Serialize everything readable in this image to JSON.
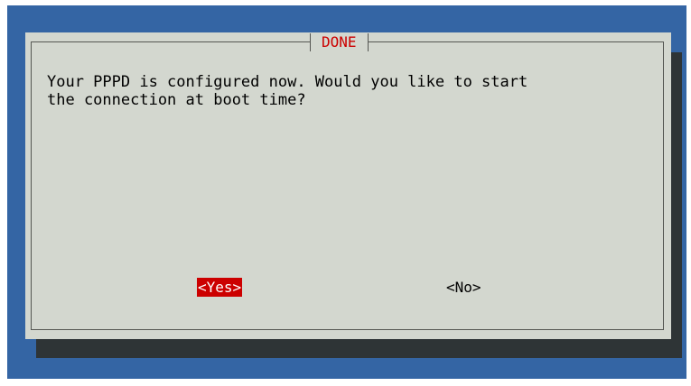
{
  "dialog": {
    "title": "DONE",
    "message": "Your PPPD is configured now. Would you like to start\nthe connection at boot time?",
    "buttons": {
      "yes_label": "<Yes>",
      "no_label": "<No>"
    }
  },
  "colors": {
    "screen_background": "#3465a4",
    "dialog_background": "#d3d7cf",
    "shadow": "#2e3436",
    "title_text": "#cc0000",
    "selected_button_bg": "#cc0000",
    "selected_button_text": "#ffffff"
  }
}
